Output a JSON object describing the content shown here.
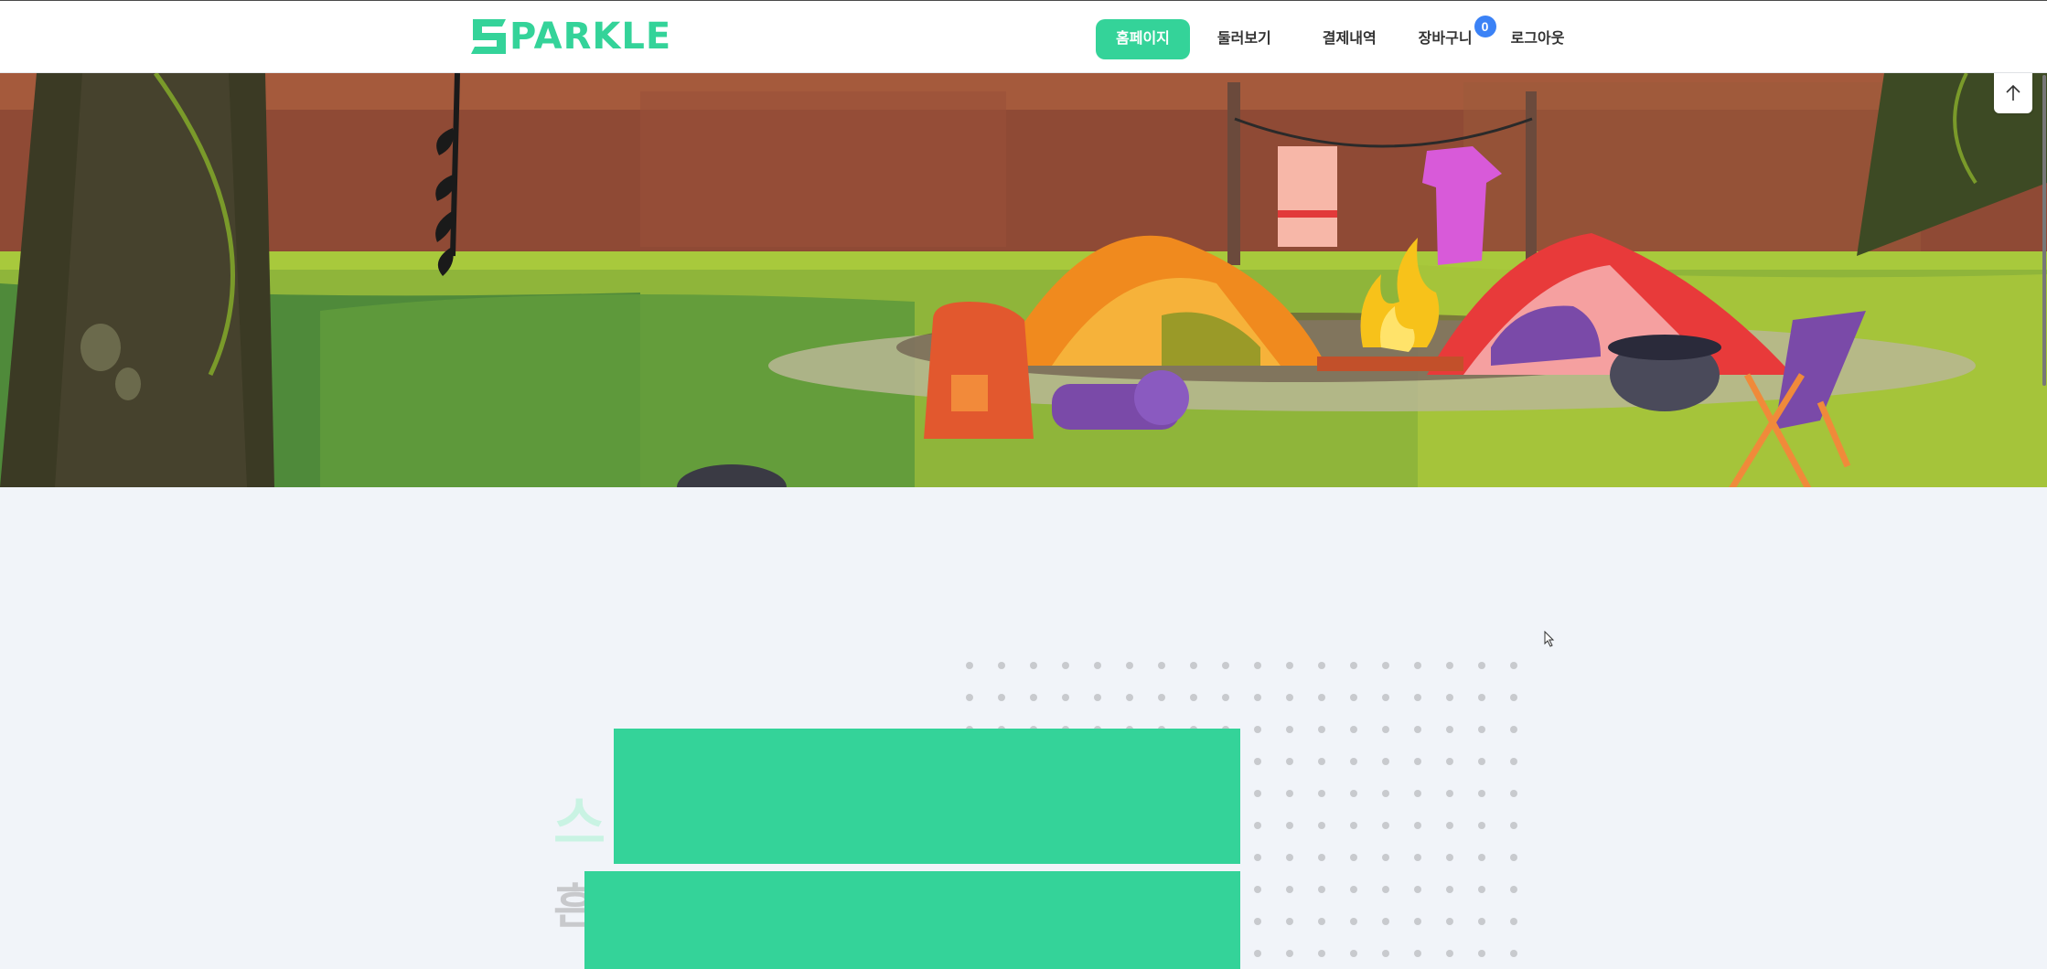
{
  "brand": {
    "logo_text": "PARKLE",
    "logo_initial": "S",
    "color": "#34d399"
  },
  "nav": {
    "items": [
      {
        "label": "홈페이지",
        "active": true
      },
      {
        "label": "둘러보기",
        "active": false
      },
      {
        "label": "결제내역",
        "active": false
      },
      {
        "label": "장바구니",
        "active": false
      },
      {
        "label": "로그아웃",
        "active": false
      }
    ],
    "cart_count": "0"
  },
  "hero": {
    "illustration": "camping-scene"
  },
  "section": {
    "ghost_title": "스",
    "ghost_subtitle": "흔"
  },
  "icons": {
    "scroll_top": "arrow-up-icon"
  },
  "colors": {
    "accent": "#34d399",
    "badge": "#3b82f6",
    "background": "#f1f4f9"
  }
}
